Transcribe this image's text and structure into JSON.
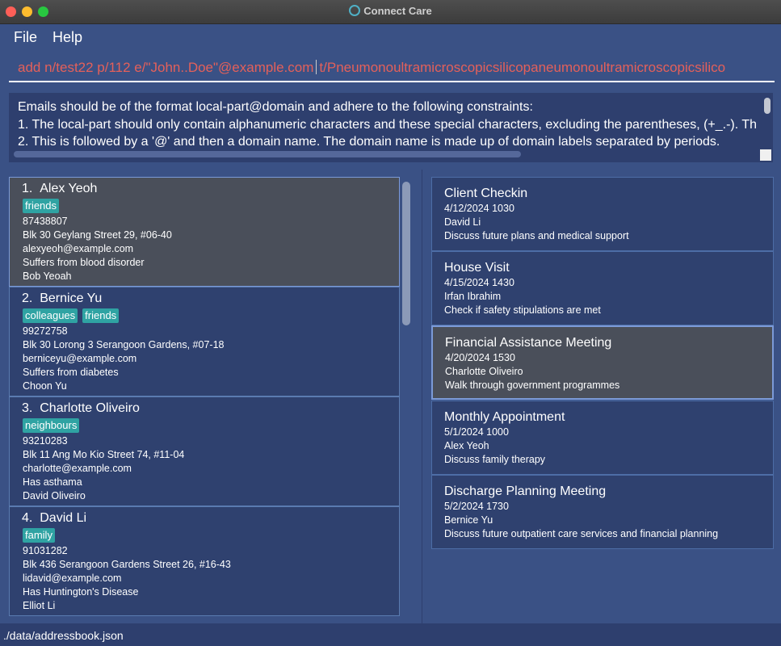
{
  "window": {
    "title": "Connect Care"
  },
  "menu": {
    "file": "File",
    "help": "Help"
  },
  "command": {
    "value": "add n/test22 p/112 e/\"John..Doe\"@example.com",
    "value_after_caret": "t/Pneumonoultramicroscopicsilicopaneumonoultramicroscopicsilico"
  },
  "result": {
    "lines": [
      "Emails should be of the format local-part@domain and adhere to the following constraints:",
      "1. The local-part should only contain alphanumeric characters and these special characters, excluding the parentheses, (+_.-). Th",
      "2. This is followed by a '@' and then a domain name. The domain name is made up of domain labels separated by periods."
    ]
  },
  "persons": [
    {
      "index": "1.",
      "name": "Alex Yeoh",
      "tags": [
        "friends"
      ],
      "phone": "87438807",
      "address": "Blk 30 Geylang Street 29, #06-40",
      "email": "alexyeoh@example.com",
      "condition": "Suffers from blood disorder",
      "contact": "Bob Yeoah",
      "selected": true
    },
    {
      "index": "2.",
      "name": "Bernice Yu",
      "tags": [
        "colleagues",
        "friends"
      ],
      "phone": "99272758",
      "address": "Blk 30 Lorong 3 Serangoon Gardens, #07-18",
      "email": "berniceyu@example.com",
      "condition": "Suffers from diabetes",
      "contact": "Choon Yu"
    },
    {
      "index": "3.",
      "name": "Charlotte Oliveiro",
      "tags": [
        "neighbours"
      ],
      "phone": "93210283",
      "address": "Blk 11 Ang Mo Kio Street 74, #11-04",
      "email": "charlotte@example.com",
      "condition": "Has asthama",
      "contact": "David Oliveiro"
    },
    {
      "index": "4.",
      "name": "David Li",
      "tags": [
        "family"
      ],
      "phone": "91031282",
      "address": "Blk 436 Serangoon Gardens Street 26, #16-43",
      "email": "lidavid@example.com",
      "condition": "Has Huntington's Disease",
      "contact": "Elliot Li"
    }
  ],
  "appointments": [
    {
      "title": "Client Checkin",
      "datetime": "4/12/2024 1030",
      "person": "David Li",
      "description": "Discuss future plans and medical support"
    },
    {
      "title": "House Visit",
      "datetime": "4/15/2024 1430",
      "person": "Irfan Ibrahim",
      "description": "Check if safety stipulations are met"
    },
    {
      "title": "Financial Assistance Meeting",
      "datetime": "4/20/2024 1530",
      "person": "Charlotte Oliveiro",
      "description": "Walk through government programmes",
      "selected": true
    },
    {
      "title": "Monthly Appointment",
      "datetime": "5/1/2024 1000",
      "person": "Alex Yeoh",
      "description": "Discuss family therapy"
    },
    {
      "title": "Discharge Planning Meeting",
      "datetime": "5/2/2024 1730",
      "person": "Bernice Yu",
      "description": "Discuss future outpatient care services and financial planning"
    }
  ],
  "status": {
    "path": "./data/addressbook.json"
  }
}
